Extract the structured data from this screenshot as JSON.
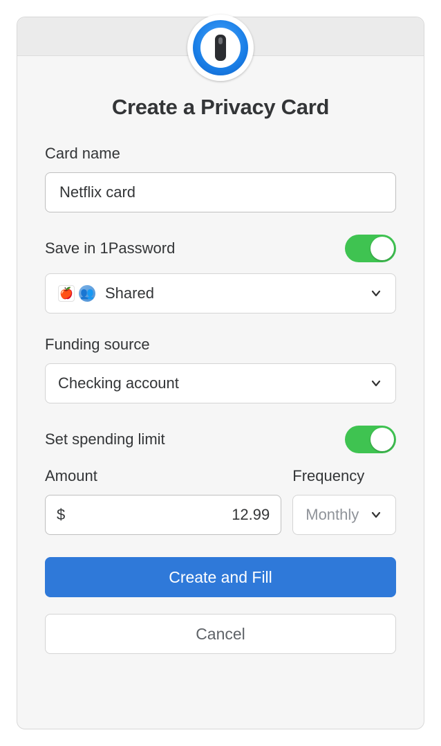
{
  "title": "Create a Privacy Card",
  "cardName": {
    "label": "Card name",
    "value": "Netflix card"
  },
  "saveIn1Password": {
    "label": "Save in 1Password",
    "enabled": true,
    "vault": "Shared"
  },
  "fundingSource": {
    "label": "Funding source",
    "value": "Checking account"
  },
  "spendingLimit": {
    "label": "Set spending limit",
    "enabled": true,
    "amount": {
      "label": "Amount",
      "currency": "$",
      "value": "12.99"
    },
    "frequency": {
      "label": "Frequency",
      "value": "Monthly"
    }
  },
  "buttons": {
    "primary": "Create and Fill",
    "secondary": "Cancel"
  }
}
